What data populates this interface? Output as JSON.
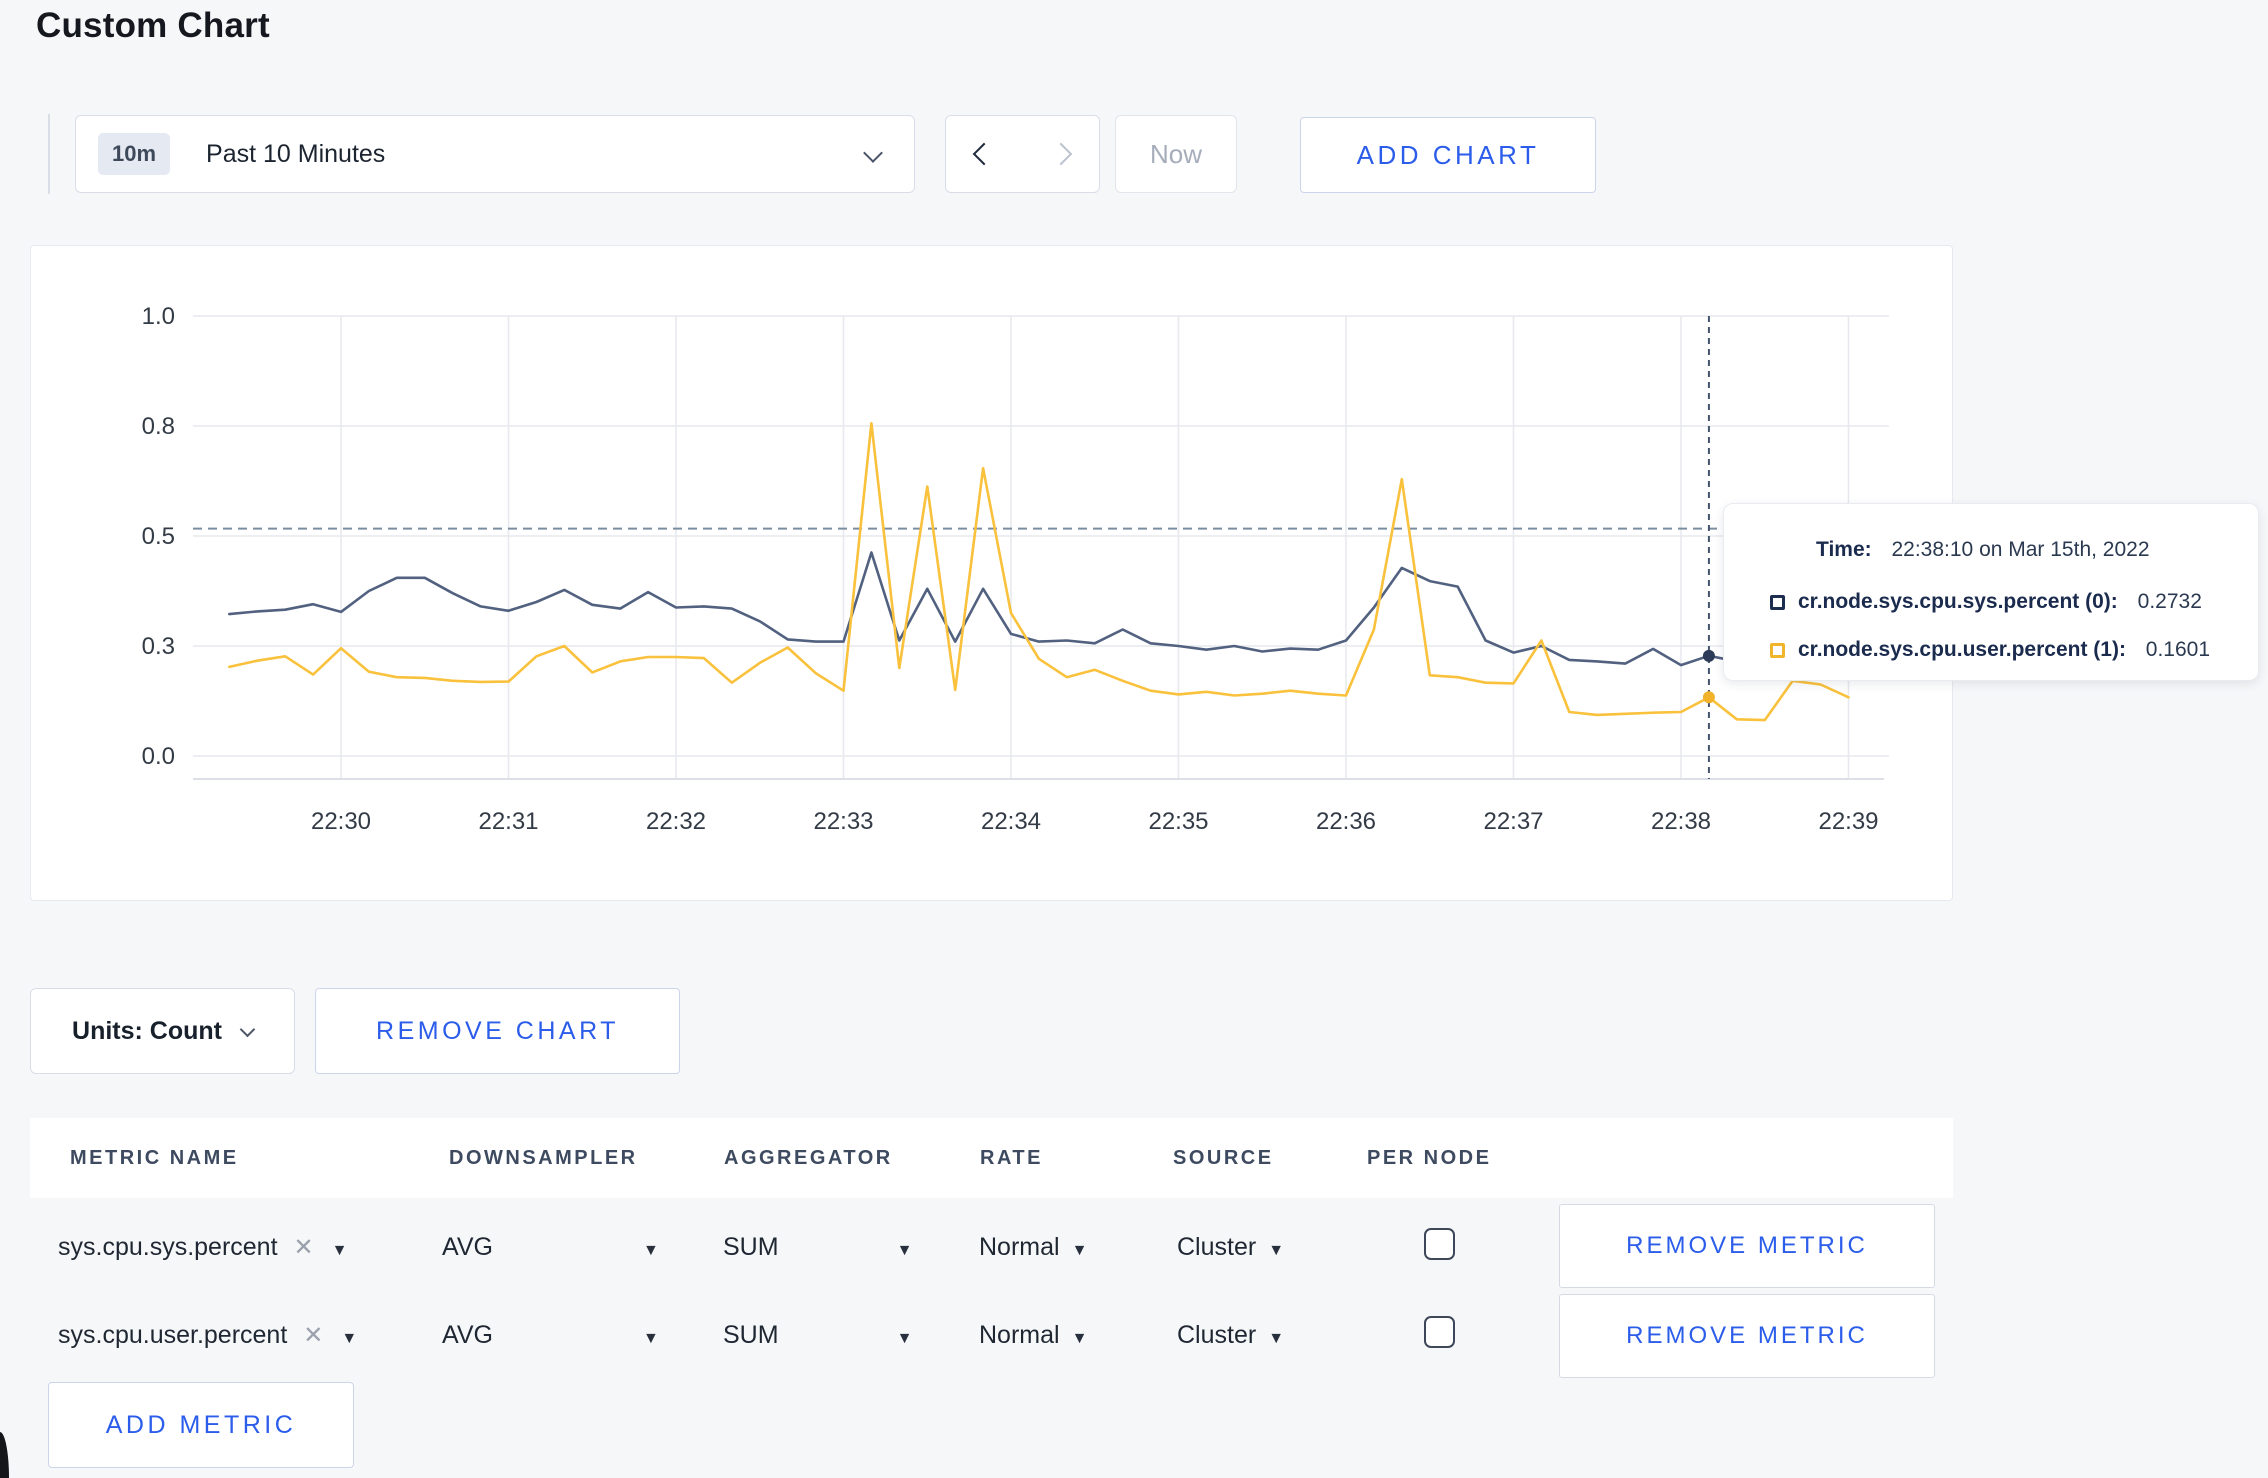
{
  "page": {
    "title": "Custom Chart"
  },
  "colors": {
    "accent_blue": "#2b5dea",
    "page_background": "#f6f7f9",
    "series_sys": "#51617f",
    "series_user": "#f9c13c",
    "grid": "#e7e9ee",
    "dashed_value_line": "#7a8da0",
    "crosshair": "#44546e"
  },
  "toolbar": {
    "time_badge": "10m",
    "time_label": "Past 10 Minutes",
    "now_label": "Now",
    "add_chart_label": "ADD CHART"
  },
  "chart_data": {
    "type": "line",
    "title": "",
    "xlabel": "",
    "ylabel": "",
    "x_start": "22:29:20",
    "x_step_seconds": 10,
    "x_tick_labels": [
      "22:30",
      "22:31",
      "22:32",
      "22:33",
      "22:34",
      "22:35",
      "22:36",
      "22:37",
      "22:38",
      "22:39"
    ],
    "y_tick_labels": [
      "1.0",
      "0.8",
      "0.5",
      "0.3",
      "0.0"
    ],
    "y_tick_values": [
      1.0,
      0.8,
      0.5,
      0.3,
      0.0
    ],
    "ylim": [
      0,
      1.0
    ],
    "grid": true,
    "legend_position": "none",
    "dashed_value_line": 0.52,
    "crosshair": {
      "time": "22:38:10",
      "index": 53
    },
    "series": [
      {
        "name": "cr.node.sys.cpu.sys.percent",
        "color": "#51617f",
        "values": [
          0.358,
          0.363,
          0.366,
          0.376,
          0.362,
          0.4,
          0.424,
          0.424,
          0.396,
          0.372,
          0.364,
          0.38,
          0.402,
          0.375,
          0.368,
          0.398,
          0.37,
          0.372,
          0.368,
          0.345,
          0.312,
          0.308,
          0.308,
          0.47,
          0.31,
          0.404,
          0.308,
          0.404,
          0.322,
          0.308,
          0.31,
          0.305,
          0.33,
          0.305,
          0.3,
          0.29,
          0.3,
          0.285,
          0.293,
          0.29,
          0.31,
          0.37,
          0.442,
          0.418,
          0.408,
          0.31,
          0.282,
          0.3,
          0.262,
          0.258,
          0.252,
          0.292,
          0.248,
          0.2732,
          0.258,
          0.27,
          0.28,
          0.268,
          0.278
        ]
      },
      {
        "name": "cr.node.sys.cpu.user.percent",
        "color": "#f9c13c",
        "values": [
          0.243,
          0.26,
          0.272,
          0.222,
          0.294,
          0.23,
          0.215,
          0.213,
          0.205,
          0.202,
          0.203,
          0.272,
          0.3,
          0.228,
          0.258,
          0.27,
          0.27,
          0.267,
          0.2,
          0.254,
          0.296,
          0.226,
          0.178,
          0.805,
          0.24,
          0.635,
          0.18,
          0.685,
          0.36,
          0.265,
          0.215,
          0.235,
          0.205,
          0.178,
          0.168,
          0.175,
          0.165,
          0.17,
          0.178,
          0.17,
          0.165,
          0.33,
          0.655,
          0.22,
          0.215,
          0.2,
          0.198,
          0.31,
          0.12,
          0.112,
          0.115,
          0.118,
          0.12,
          0.1601,
          0.1,
          0.098,
          0.205,
          0.195,
          0.16
        ]
      }
    ]
  },
  "tooltip": {
    "time_label": "Time:",
    "time_value": "22:38:10 on Mar 15th, 2022",
    "series": [
      {
        "label": "cr.node.sys.cpu.sys.percent (0):",
        "value": "0.2732",
        "swatch_color": "#1d2d50"
      },
      {
        "label": "cr.node.sys.cpu.user.percent (1):",
        "value": "0.1601",
        "swatch_color": "#f1b52c"
      }
    ]
  },
  "chart_footer": {
    "units_label": "Units: Count",
    "remove_chart_label": "REMOVE CHART"
  },
  "metrics_table": {
    "headers": [
      "METRIC NAME",
      "DOWNSAMPLER",
      "AGGREGATOR",
      "RATE",
      "SOURCE",
      "PER NODE"
    ],
    "rows": [
      {
        "name": "sys.cpu.sys.percent",
        "downsampler": "AVG",
        "aggregator": "SUM",
        "rate": "Normal",
        "source": "Cluster",
        "per_node_checked": false,
        "remove_label": "REMOVE METRIC"
      },
      {
        "name": "sys.cpu.user.percent",
        "downsampler": "AVG",
        "aggregator": "SUM",
        "rate": "Normal",
        "source": "Cluster",
        "per_node_checked": false,
        "remove_label": "REMOVE METRIC"
      }
    ],
    "add_metric_label": "ADD METRIC"
  }
}
